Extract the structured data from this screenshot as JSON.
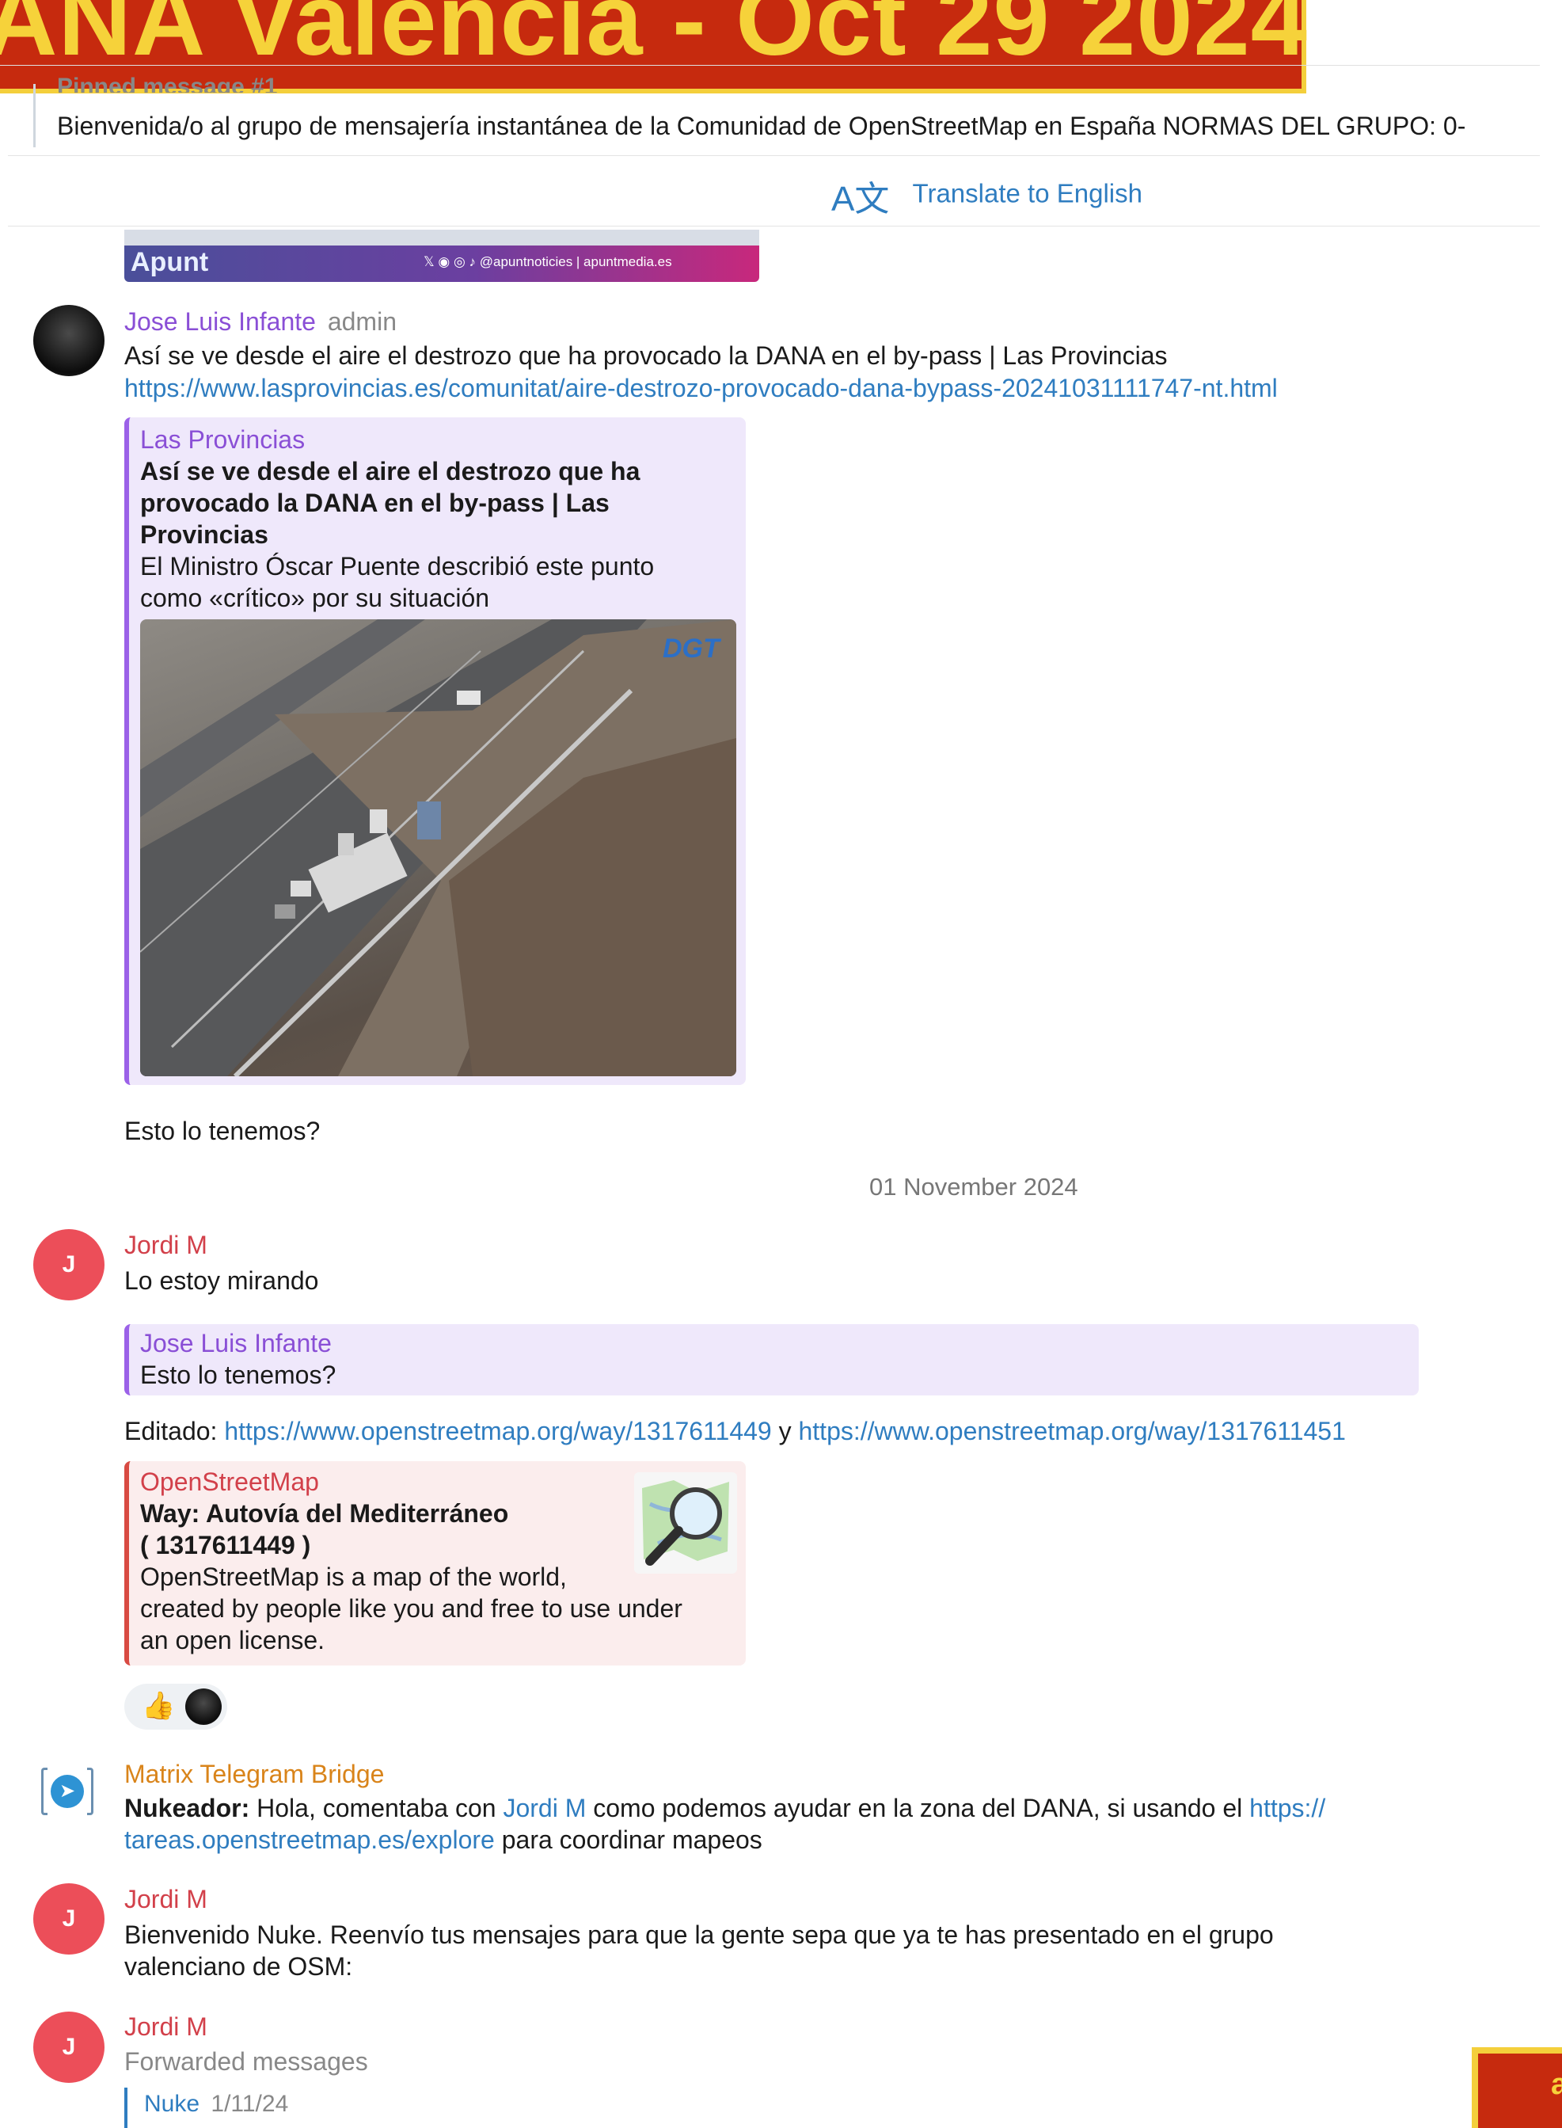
{
  "banner": {
    "title": "ANA Valencia - Oct 29 2024"
  },
  "pinned": {
    "header": "Pinned message #1",
    "text": "Bienvenida/o al grupo de mensajería instantánea de la Comunidad de OpenStreetMap en España  NORMAS DEL GRUPO:  0-"
  },
  "translate": {
    "icon": "translate-icon",
    "label": "Translate to English"
  },
  "top_image": {
    "logo": "Apunt",
    "social": "𝕏 ◉ ◎ ♪  @apuntnoticies | apuntmedia.es"
  },
  "msg1": {
    "sender": "Jose Luis Infante",
    "role": "admin",
    "text": "Así se ve desde el aire el destrozo que ha provocado la DANA en el by-pass | Las Provincias",
    "url": "https://www.lasprovincias.es/comunitat/aire-destrozo-provocado-dana-bypass-20241031111747-nt.html",
    "preview": {
      "site": "Las Provincias",
      "title_lines": [
        "Así se ve desde el aire el destrozo que ha",
        "provocado la DANA en el by-pass | Las",
        "Provincias"
      ],
      "desc_lines": [
        "El Ministro Óscar Puente describió este punto",
        "como «crítico» por su situación"
      ],
      "watermark": "DGT"
    },
    "followup": "Esto lo tenemos?"
  },
  "date_divider": "01 November 2024",
  "msg2": {
    "sender": "Jordi M",
    "avatar": "J",
    "text": "Lo estoy mirando",
    "reply": {
      "sender": "Jose Luis Infante",
      "text": "Esto lo tenemos?"
    },
    "edit_prefix": "Editado: ",
    "link1": "https://www.openstreetmap.org/way/1317611449",
    "link_sep": " y ",
    "link2": "https://www.openstreetmap.org/way/1317611451",
    "preview": {
      "site": "OpenStreetMap",
      "title_lines": [
        "Way:  Autovía del Mediterráneo",
        "( 1317611449 )"
      ],
      "desc_lines": [
        "OpenStreetMap is a map of the world,",
        "created by people like you and free to use under",
        "an open license."
      ]
    },
    "reaction": "👍"
  },
  "msg3": {
    "sender": "Matrix Telegram Bridge",
    "bold_prefix": "Nukeador:",
    "text_a": " Hola, comentaba con ",
    "mention": "Jordi M",
    "text_b": " como podemos ayudar en la zona del DANA, si usando el ",
    "link_a": "https://",
    "link_b": "tareas.openstreetmap.es/explore",
    "text_c": " para coordinar mapeos"
  },
  "msg4": {
    "sender": "Jordi M",
    "avatar": "J",
    "line1": "Bienvenido Nuke. Reenvío tus mensajes para que la gente sepa que ya te has presentado en el grupo",
    "line2": "valenciano de OSM:"
  },
  "msg5": {
    "sender": "Jordi M",
    "avatar": "J",
    "subtitle": "Forwarded messages",
    "fwd_sender": "Nuke",
    "fwd_date": "1/11/24"
  },
  "corner_badge": "a"
}
